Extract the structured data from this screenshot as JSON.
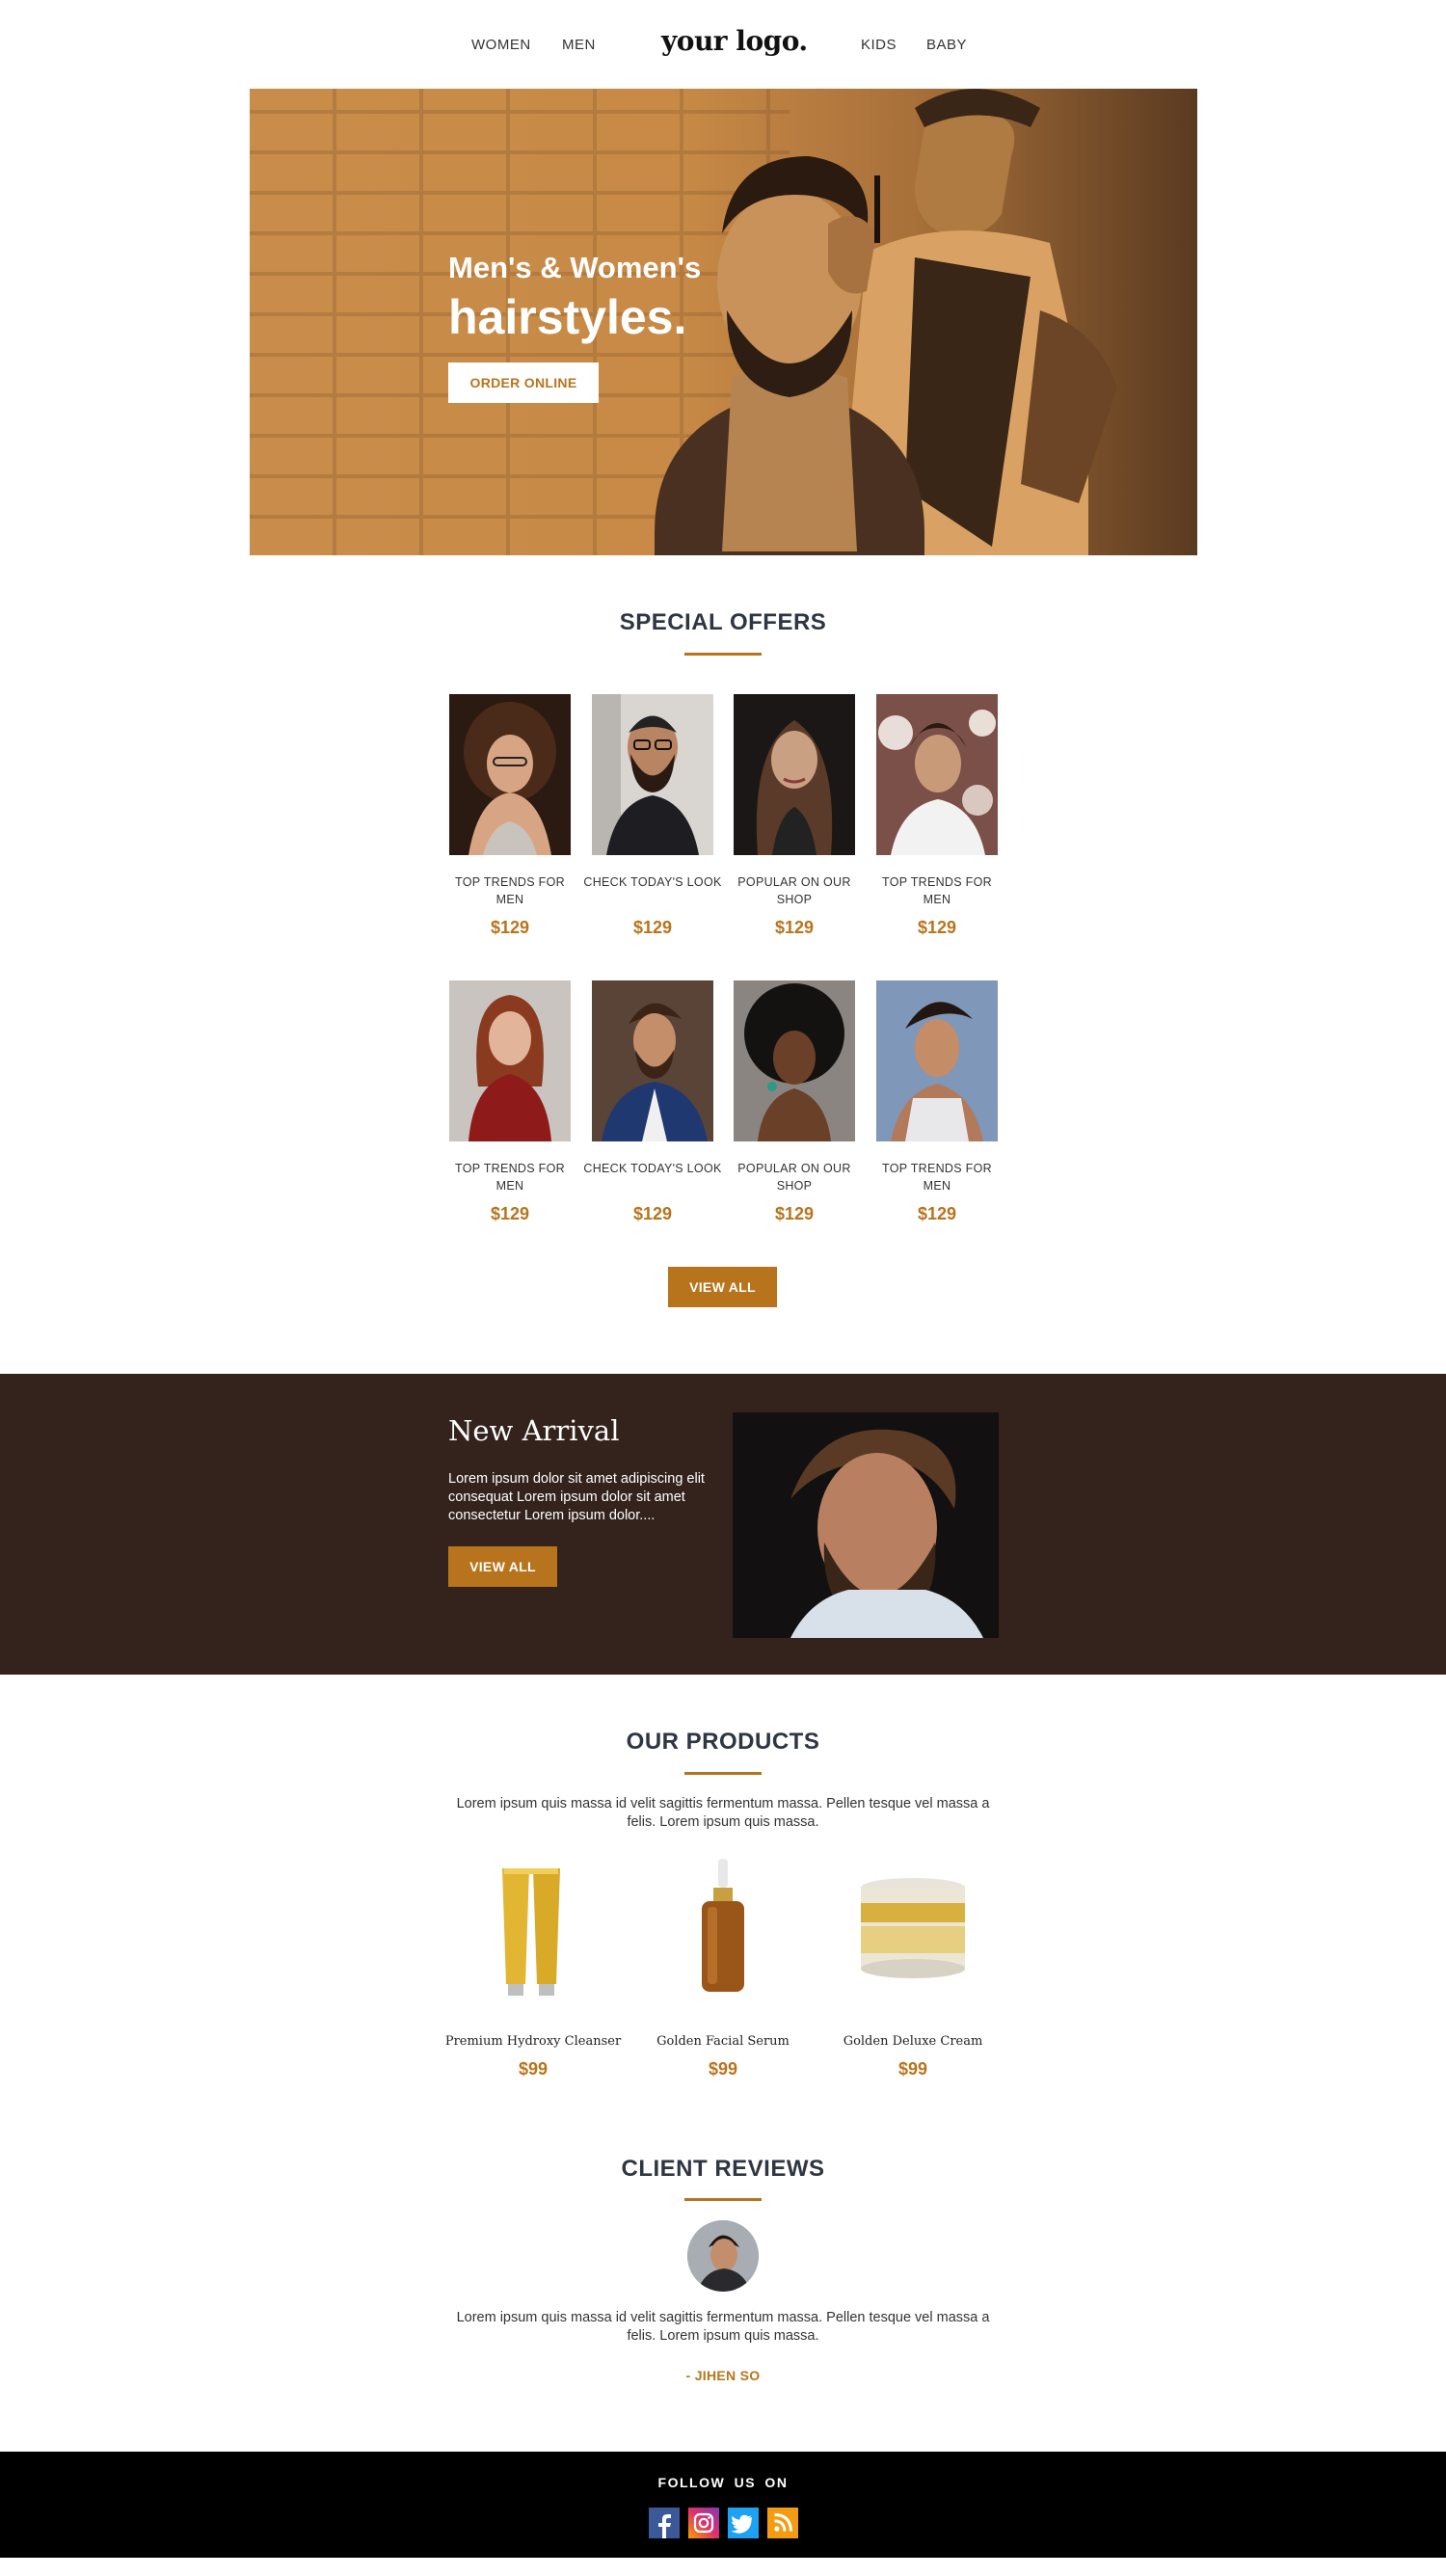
{
  "header": {
    "nav_left": [
      "WOMEN",
      "MEN"
    ],
    "logo": "your logo.",
    "nav_right": [
      "KIDS",
      "BABY"
    ]
  },
  "hero": {
    "subtitle": "Men's & Women's",
    "title": "hairstyles.",
    "button": "ORDER ONLINE"
  },
  "offers": {
    "title": "SPECIAL OFFERS",
    "items": [
      {
        "label": "TOP TRENDS FOR MEN",
        "price": "$129",
        "image": "woman-curly-hair-glasses"
      },
      {
        "label": "CHECK TODAY'S LOOK",
        "price": "$129",
        "image": "man-beard-glasses"
      },
      {
        "label": "POPULAR ON OUR SHOP",
        "price": "$129",
        "image": "woman-long-dark-hair"
      },
      {
        "label": "TOP TRENDS FOR MEN",
        "price": "$129",
        "image": "man-wavy-hair"
      },
      {
        "label": "TOP TRENDS FOR MEN",
        "price": "$129",
        "image": "woman-red-hair"
      },
      {
        "label": "CHECK TODAY'S LOOK",
        "price": "$129",
        "image": "man-blue-suit"
      },
      {
        "label": "POPULAR ON OUR SHOP",
        "price": "$129",
        "image": "woman-afro-hair"
      },
      {
        "label": "TOP TRENDS FOR MEN",
        "price": "$129",
        "image": "man-styled-hair"
      }
    ],
    "button": "VIEW ALL"
  },
  "arrival": {
    "title": "New Arrival",
    "text": "Lorem ipsum dolor sit amet adipiscing elit consequat Lorem ipsum dolor sit amet consectetur Lorem ipsum dolor....",
    "button": "VIEW ALL"
  },
  "products": {
    "title": "OUR PRODUCTS",
    "text": "Lorem ipsum quis massa id velit sagittis fermentum massa. Pellen tesque vel massa a felis. Lorem ipsum quis massa.",
    "items": [
      {
        "name": "Premium Hydroxy Cleanser",
        "price": "$99",
        "image": "cream-tubes"
      },
      {
        "name": "Golden Facial Serum",
        "price": "$99",
        "image": "serum-bottle"
      },
      {
        "name": "Golden Deluxe Cream",
        "price": "$99",
        "image": "cream-jar"
      }
    ]
  },
  "reviews": {
    "title": "CLIENT REVIEWS",
    "text": "Lorem ipsum quis massa id velit sagittis fermentum massa. Pellen tesque vel massa a felis. Lorem ipsum quis massa.",
    "author": "- JIHEN SO"
  },
  "footer": {
    "follow": "FOLLOW US ON",
    "social": [
      "facebook-icon",
      "instagram-icon",
      "twitter-icon",
      "rss-icon"
    ]
  },
  "colors": {
    "accent": "#b8741c",
    "dark_band": "#33231c",
    "heading": "#2f3542",
    "footer": "#000000"
  }
}
